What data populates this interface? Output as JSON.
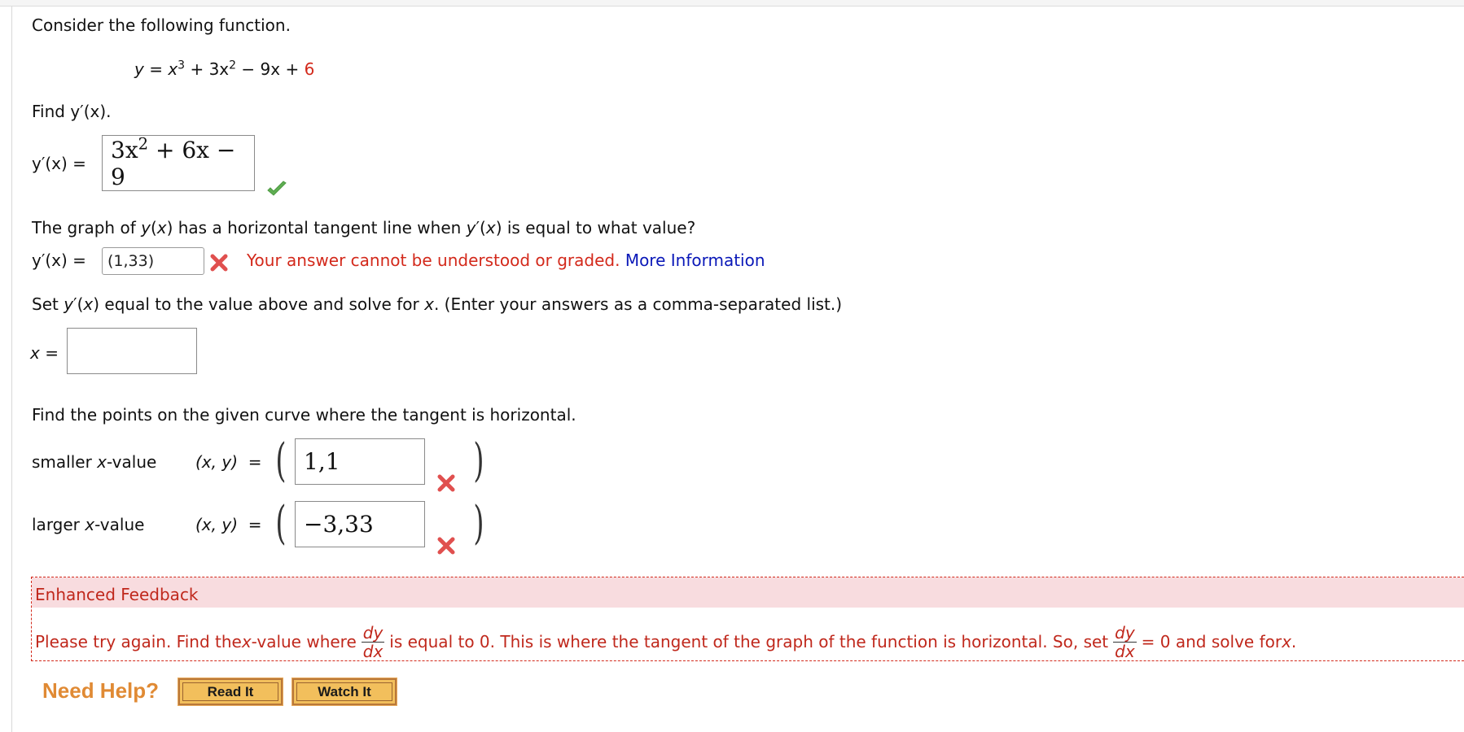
{
  "intro": "Consider the following function.",
  "function": {
    "lhs": "y",
    "eq": "=",
    "terms": [
      "x",
      "3",
      "+ 3x",
      "2",
      "− 9x +"
    ],
    "constant": "6",
    "constant_color": "#d3291b"
  },
  "q1": {
    "prompt": "Find y′(x).",
    "label": "y′(x) =",
    "answer_parts": [
      "3x",
      "2",
      " + 6x − 9"
    ],
    "status": "correct",
    "status_icon": "check-icon"
  },
  "q2": {
    "prompt_parts": [
      "The graph of ",
      "y",
      "(",
      "x",
      ") has a horizontal tangent line when ",
      "y",
      "′(",
      "x",
      ") is equal to what value?"
    ],
    "label": "y′(x) =",
    "input_value": "(1,33)",
    "status": "error",
    "status_icon": "x-icon",
    "error_message": "Your answer cannot be understood or graded.",
    "more_info_link": "More Information"
  },
  "q3": {
    "prompt_parts": [
      "Set ",
      "y",
      "′(",
      "x",
      ") equal to the value above and solve for ",
      "x",
      ". (Enter your answers as a comma-separated list.)"
    ],
    "label": "x =",
    "input_value": ""
  },
  "q4": {
    "prompt": "Find the points on the given curve where the tangent is horizontal.",
    "rows": [
      {
        "label_pre": "smaller ",
        "label_var": "x",
        "label_post": "-value",
        "coord_label": "(x, y)  =",
        "answer": "1,1",
        "status": "incorrect"
      },
      {
        "label_pre": "larger ",
        "label_var": "x",
        "label_post": "-value",
        "coord_label": "(x, y)  =",
        "answer": "−3,33",
        "status": "incorrect"
      }
    ]
  },
  "feedback": {
    "title": "Enhanced Feedback",
    "text_1": "Please try again. Find the ",
    "text_var1": "x",
    "text_2": "-value where",
    "frac_num": "dy",
    "frac_den": "dx",
    "text_3": "is equal to 0. This is where the tangent of the graph of the function is horizontal. So, set",
    "text_4": "= 0 and solve for ",
    "text_var2": "x",
    "text_5": ".",
    "color": "#c0281c"
  },
  "help": {
    "label": "Need Help?",
    "buttons": [
      "Read It",
      "Watch It"
    ]
  }
}
